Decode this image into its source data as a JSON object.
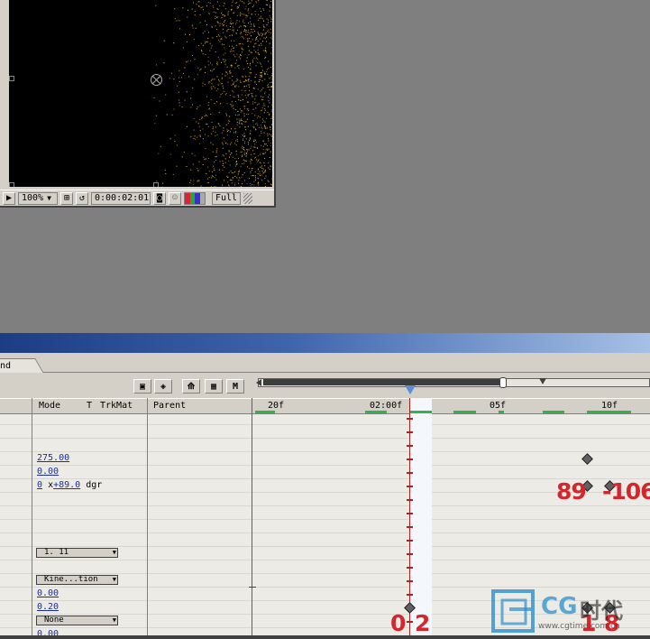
{
  "comp": {
    "zoom": "100%",
    "timecode": "0:00:02:01",
    "resolution": "Full",
    "icons": [
      "region-icon",
      "zoom-dropdown-icon",
      "grid-icon",
      "mask-icon",
      "camera-icon",
      "person-icon",
      "channel-icon"
    ]
  },
  "timeline": {
    "tab_label": "nd",
    "toolbar_buttons": [
      "live-update-icon",
      "draft-3d-icon",
      "frame-blend-icon",
      "motion-blur-icon",
      "M"
    ],
    "columns": {
      "mode": "Mode",
      "t": "T",
      "trkmat": "TrkMat",
      "parent": "Parent"
    },
    "ruler_ticks": [
      "20f",
      "02:00f",
      "05f",
      "10f"
    ],
    "values": {
      "v1": "275.00",
      "v2": "0.00",
      "v3_rev": "0",
      "v3_x": "x",
      "v3_deg": "+89.0",
      "v3_unit": "dgr",
      "dd1": "1. 11",
      "dd2": "Kine...tion",
      "v4": "0.00",
      "v5": "0.20",
      "dd3": "None",
      "v6": "0.00"
    }
  },
  "annotations": {
    "a1": "89",
    "a2": "-106",
    "a3": "0",
    "a4": "2",
    "a5": "1",
    "a6": "8"
  },
  "watermark": {
    "brand": "CG",
    "suffix": "时代",
    "url": "www.cgtime.com.cn"
  },
  "colors": {
    "cti": "#b02020",
    "work_area": "#2db54a",
    "title_start": "#1c3c84",
    "annotation": "#d3262d"
  }
}
